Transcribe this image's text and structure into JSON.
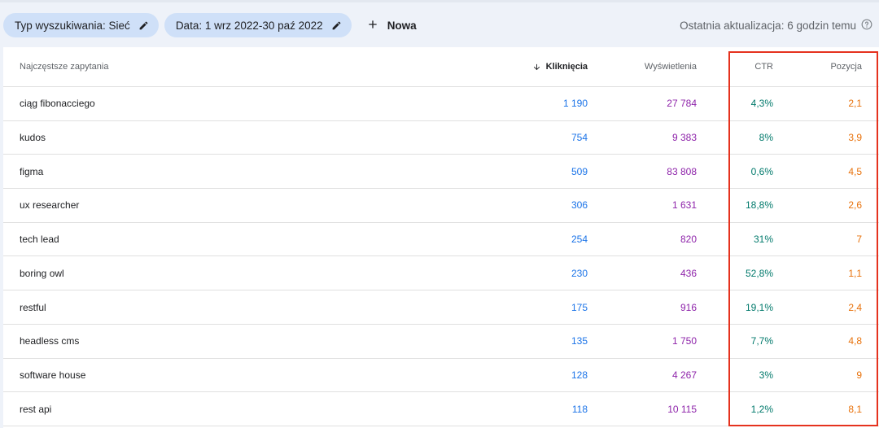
{
  "filters": {
    "search_type_label": "Typ wyszukiwania: Sieć",
    "date_label": "Data: 1 wrz 2022-30 paź 2022",
    "new_label": "Nowa"
  },
  "last_update": "Ostatnia aktualizacja: 6 godzin temu",
  "table": {
    "headers": {
      "query": "Najczęstsze zapytania",
      "clicks": "Kliknięcia",
      "impressions": "Wyświetlenia",
      "ctr": "CTR",
      "position": "Pozycja"
    },
    "rows": [
      {
        "query": "ciąg fibonacciego",
        "clicks": "1 190",
        "impressions": "27 784",
        "ctr": "4,3%",
        "position": "2,1"
      },
      {
        "query": "kudos",
        "clicks": "754",
        "impressions": "9 383",
        "ctr": "8%",
        "position": "3,9"
      },
      {
        "query": "figma",
        "clicks": "509",
        "impressions": "83 808",
        "ctr": "0,6%",
        "position": "4,5"
      },
      {
        "query": "ux researcher",
        "clicks": "306",
        "impressions": "1 631",
        "ctr": "18,8%",
        "position": "2,6"
      },
      {
        "query": "tech lead",
        "clicks": "254",
        "impressions": "820",
        "ctr": "31%",
        "position": "7"
      },
      {
        "query": "boring owl",
        "clicks": "230",
        "impressions": "436",
        "ctr": "52,8%",
        "position": "1,1"
      },
      {
        "query": "restful",
        "clicks": "175",
        "impressions": "916",
        "ctr": "19,1%",
        "position": "2,4"
      },
      {
        "query": "headless cms",
        "clicks": "135",
        "impressions": "1 750",
        "ctr": "7,7%",
        "position": "4,8"
      },
      {
        "query": "software house",
        "clicks": "128",
        "impressions": "4 267",
        "ctr": "3%",
        "position": "9"
      },
      {
        "query": "rest api",
        "clicks": "118",
        "impressions": "10 115",
        "ctr": "1,2%",
        "position": "8,1"
      }
    ]
  },
  "colors": {
    "clicks": "#1a73e8",
    "impressions": "#8e24aa",
    "ctr": "#00796b",
    "position": "#e8710a",
    "highlight": "#e5321e"
  }
}
